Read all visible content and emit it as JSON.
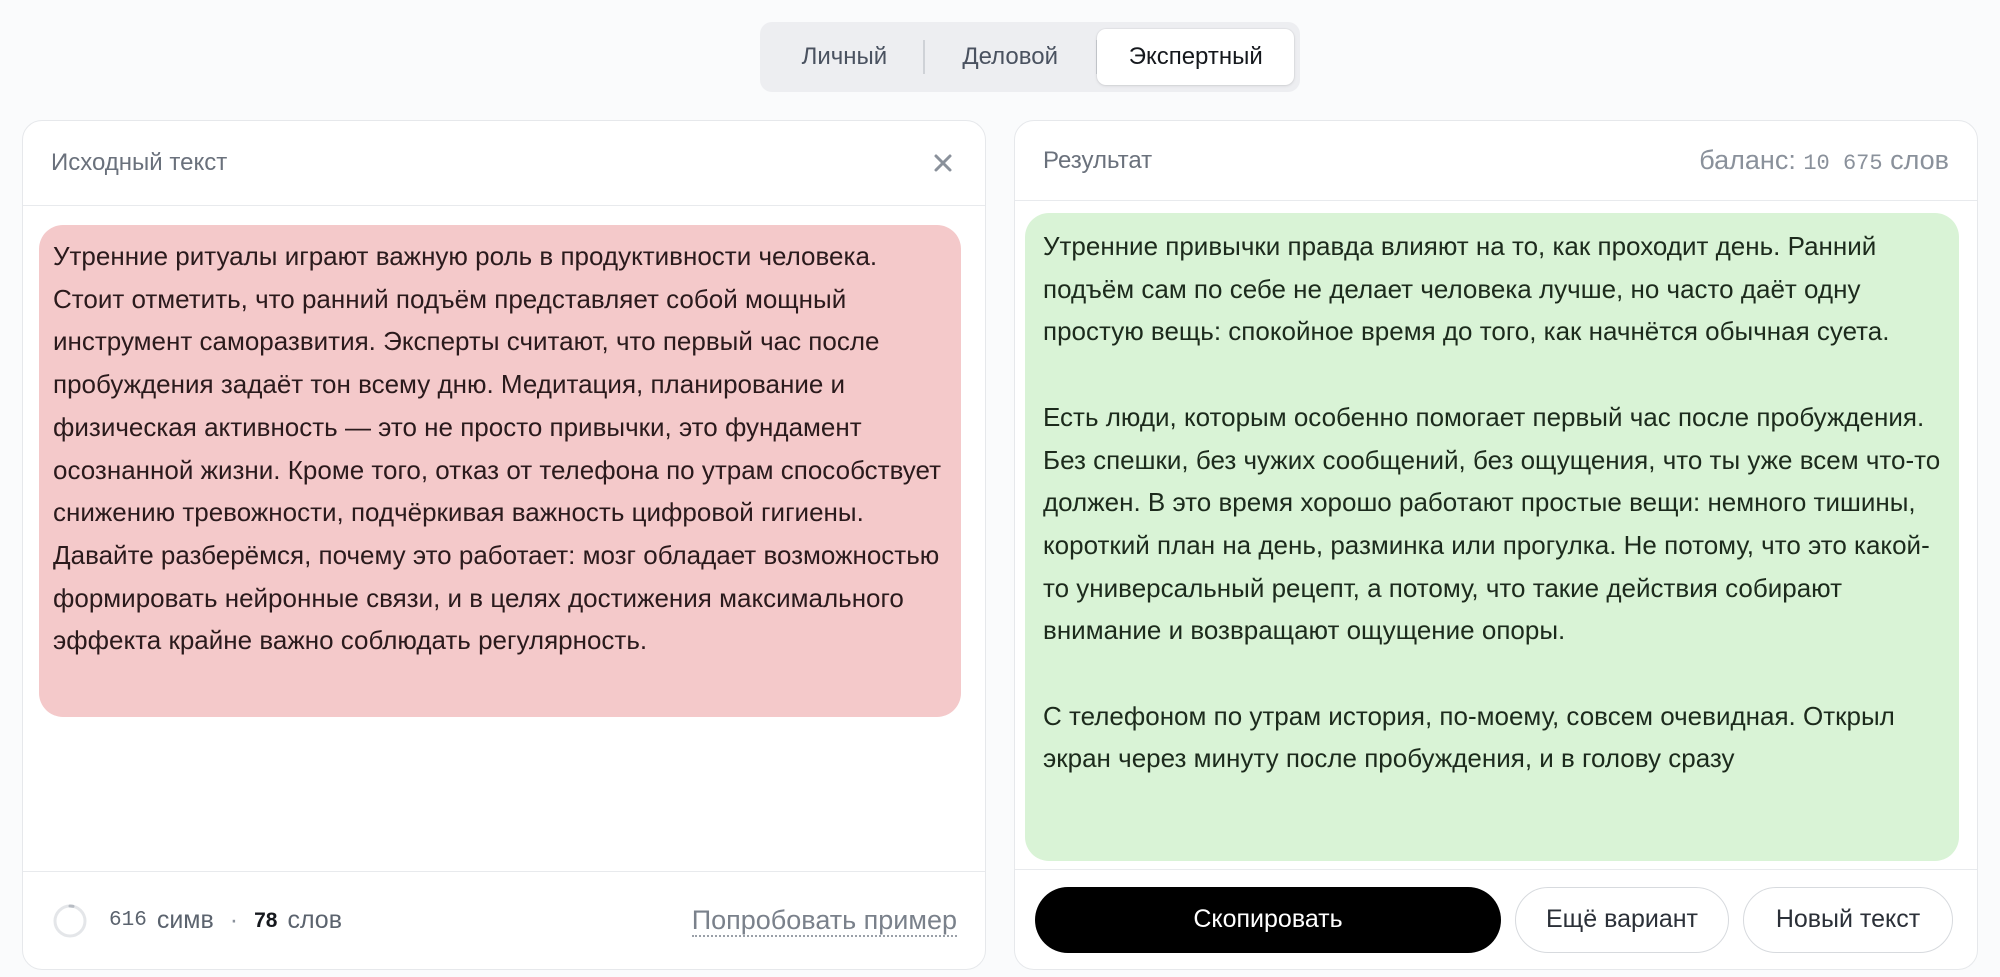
{
  "tabs": [
    "Личный",
    "Деловой",
    "Экспертный"
  ],
  "active_tab": "Экспертный",
  "source": {
    "title": "Исходный текст",
    "close_icon": "close-icon",
    "text": "Утренние ритуалы играют важную роль в продуктивности человека. Стоит отметить, что ранний подъём представляет собой мощный инструмент саморазвития. Эксперты считают, что первый час после пробуждения задаёт тон всему дню. Медитация, планирование и физическая активность — это не просто привычки, это фундамент осознанной жизни. Кроме того, отказ от телефона по утрам способствует снижению тревожности, подчёркивая важность цифровой гигиены. Давайте разберёмся, почему это работает: мозг обладает возможностью формировать нейронные связи, и в целях достижения максимального эффекта крайне важно соблюдать регулярность.",
    "chars_value": "616",
    "chars_label": "симв",
    "separator": "·",
    "words_value": "78",
    "words_label": "слов",
    "try_example": "Попробовать пример",
    "highlight_color": "#f4c9ca"
  },
  "result": {
    "title": "Результат",
    "balance_label": "баланс:",
    "balance_value": "10 675",
    "balance_unit": "слов",
    "paragraphs": [
      "Утренние привычки правда влияют на то, как проходит день. Ранний подъём сам по себе не делает человека лучше, но часто даёт одну простую вещь: спокойное время до того, как начнётся обычная суета.",
      "Есть люди, которым особенно помогает первый час после пробуждения. Без спешки, без чужих сообщений, без ощущения, что ты уже всем что-то должен. В это время хорошо работают простые вещи: немного тишины, короткий план на день, разминка или прогулка. Не потому, что это какой-то универсальный рецепт, а потому, что такие действия собирают внимание и возвращают ощущение опоры.",
      "С телефоном по утрам история, по-моему, совсем очевидная. Открыл экран через минуту после пробуждения, и в голову сразу"
    ],
    "highlight_color": "#d9f3d6",
    "buttons": {
      "copy": "Скопировать",
      "again": "Ещё вариант",
      "new_text": "Новый текст"
    }
  }
}
